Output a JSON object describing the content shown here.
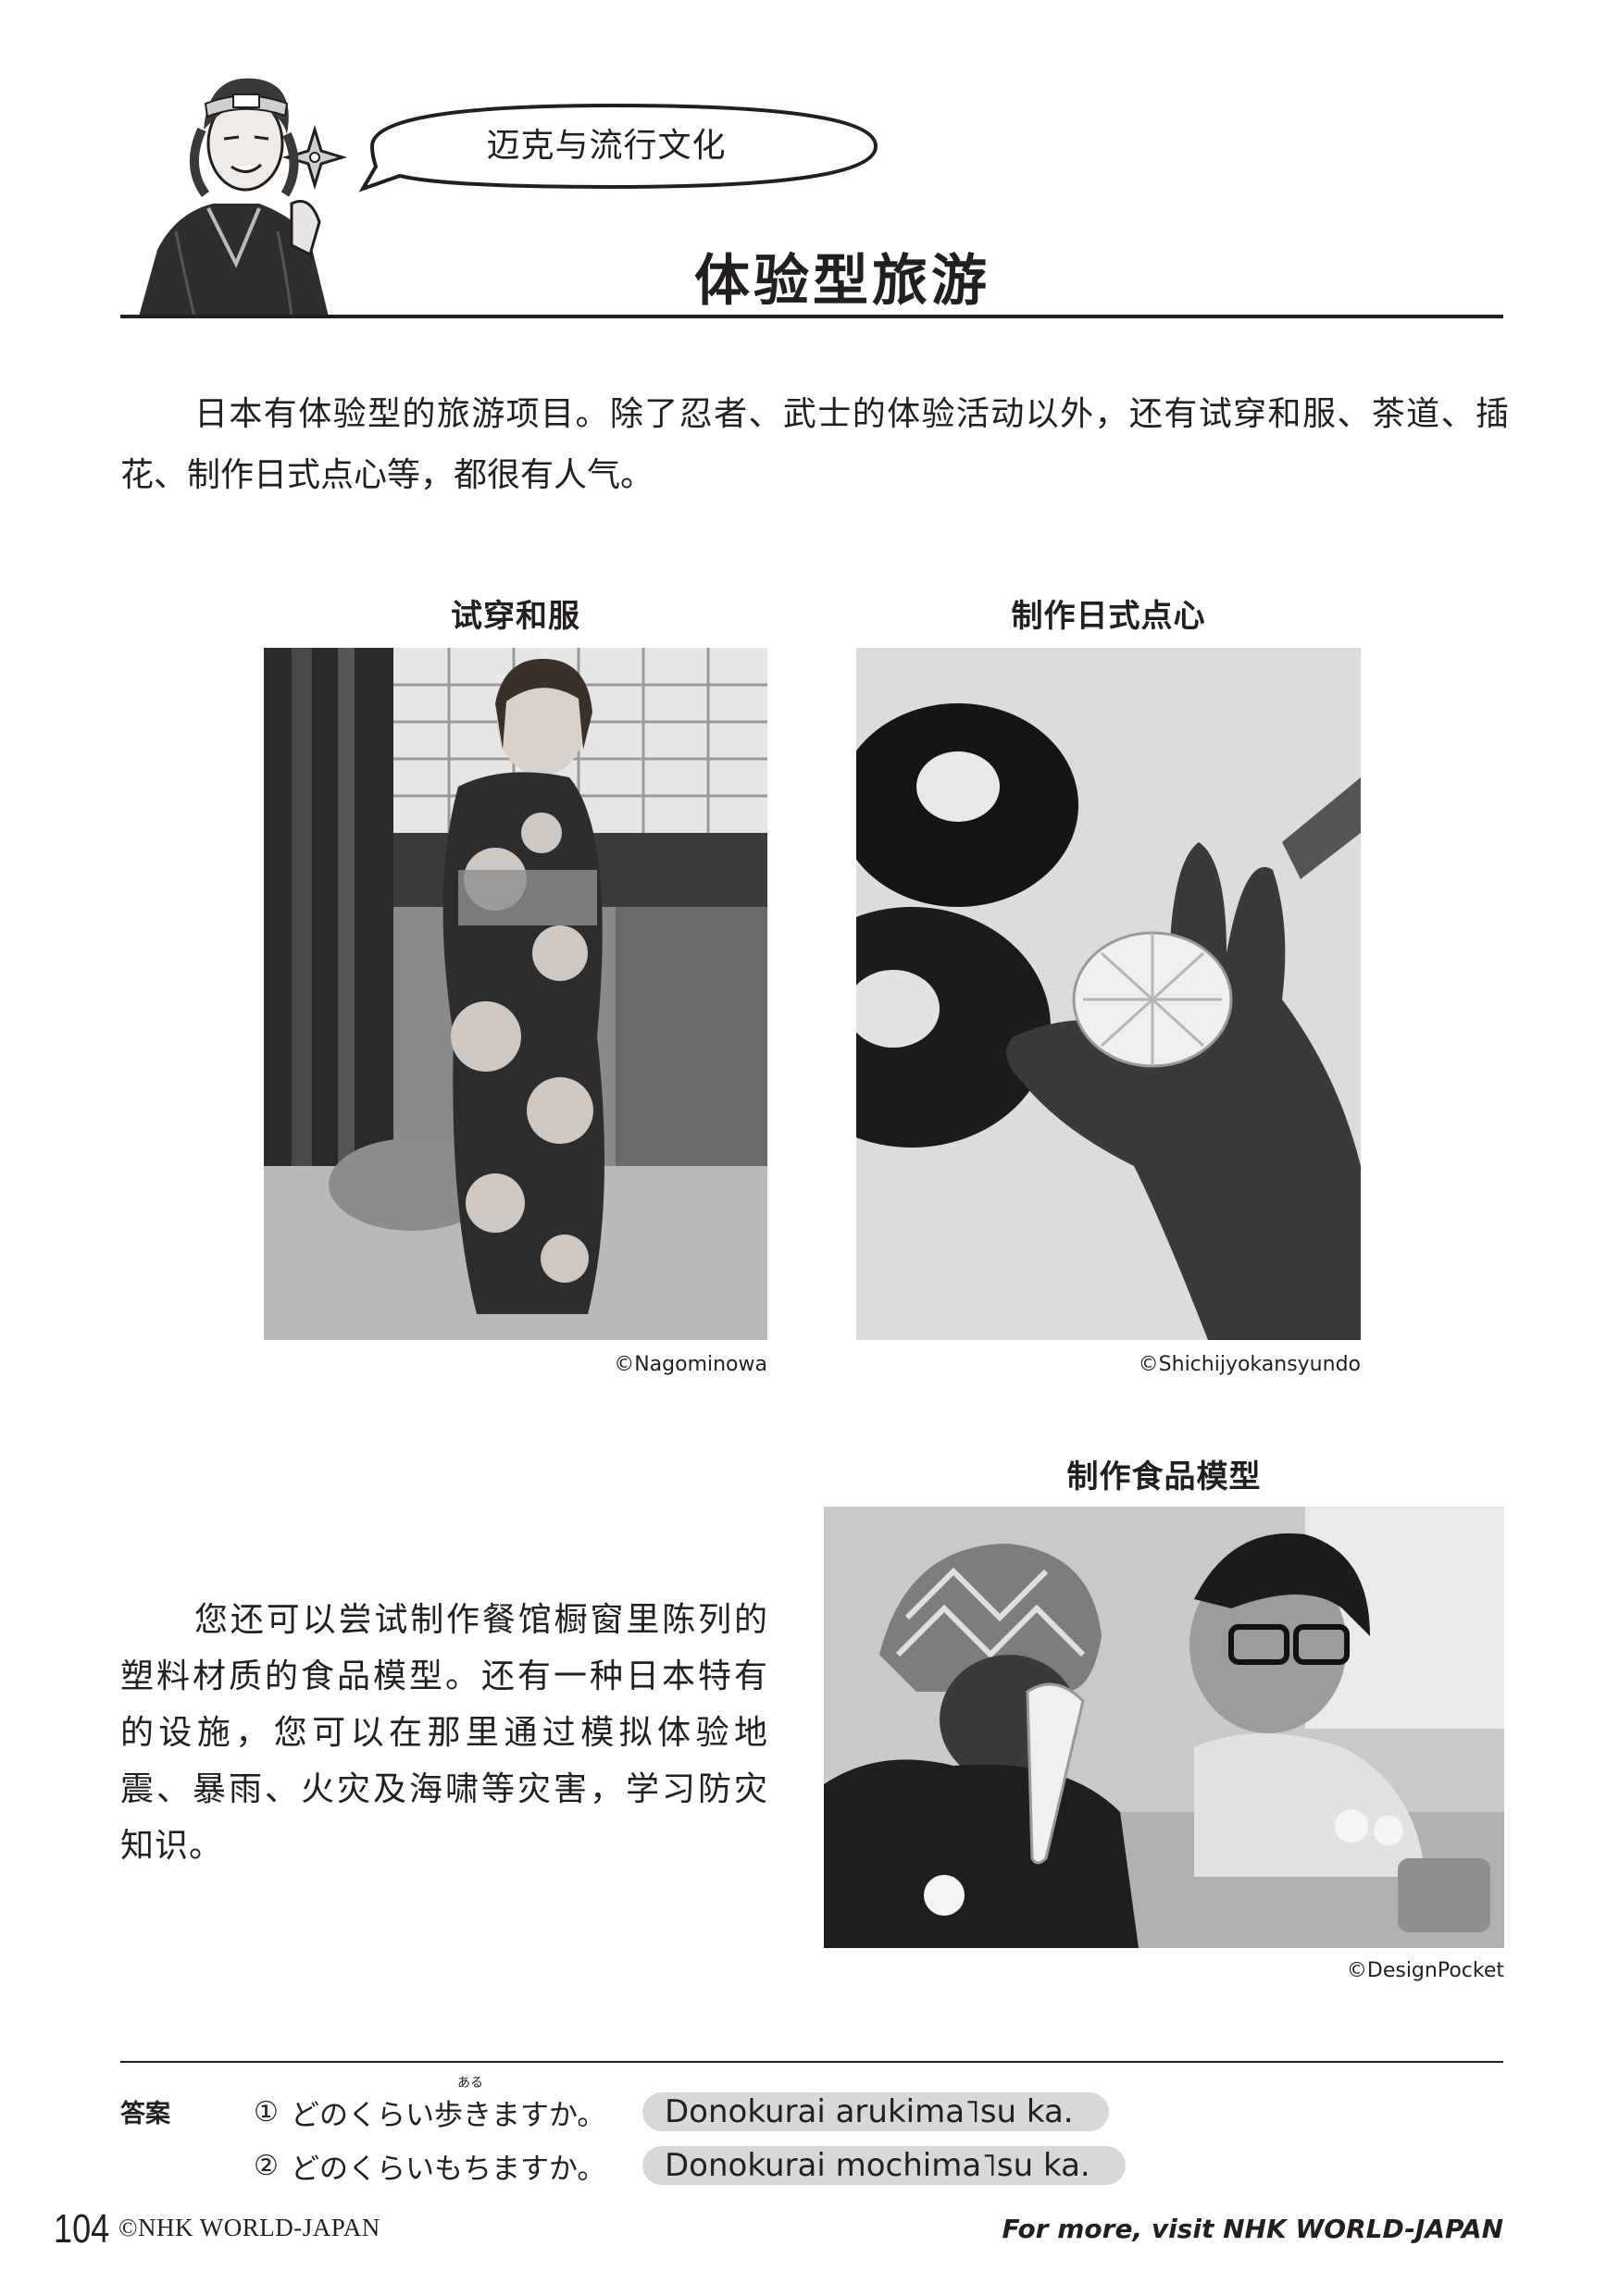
{
  "header": {
    "speech_bubble": "迈克与流行文化",
    "title": "体验型旅游"
  },
  "intro_text": "日本有体验型的旅游项目。除了忍者、武士的体验活动以外，还有试穿和服、茶道、插花、制作日式点心等，都很有人气。",
  "photos": [
    {
      "caption": "试穿和服",
      "credit": "©Nagominowa"
    },
    {
      "caption": "制作日式点心",
      "credit": "©Shichijyokansyundo"
    },
    {
      "caption": "制作食品模型",
      "credit": "©DesignPocket"
    }
  ],
  "body_text": "您还可以尝试制作餐馆橱窗里陈列的塑料材质的食品模型。还有一种日本特有的设施，您可以在那里通过模拟体验地震、暴雨、火灾及海啸等灾害，学习防灾知识。",
  "answers": {
    "label": "答案",
    "items": [
      {
        "num": "①",
        "japanese": "どのくらい歩きますか。",
        "ruby": "ある",
        "romaji": "Donokurai arukima˥su ka."
      },
      {
        "num": "②",
        "japanese": "どのくらいもちますか。",
        "romaji": "Donokurai mochima˥su ka."
      }
    ]
  },
  "footer": {
    "page_number": "104",
    "copyright": "©NHK WORLD-JAPAN",
    "visit": "For more, visit NHK WORLD-JAPAN"
  },
  "colors": {
    "text": "#231f20",
    "pill": "#d8d8d8"
  }
}
